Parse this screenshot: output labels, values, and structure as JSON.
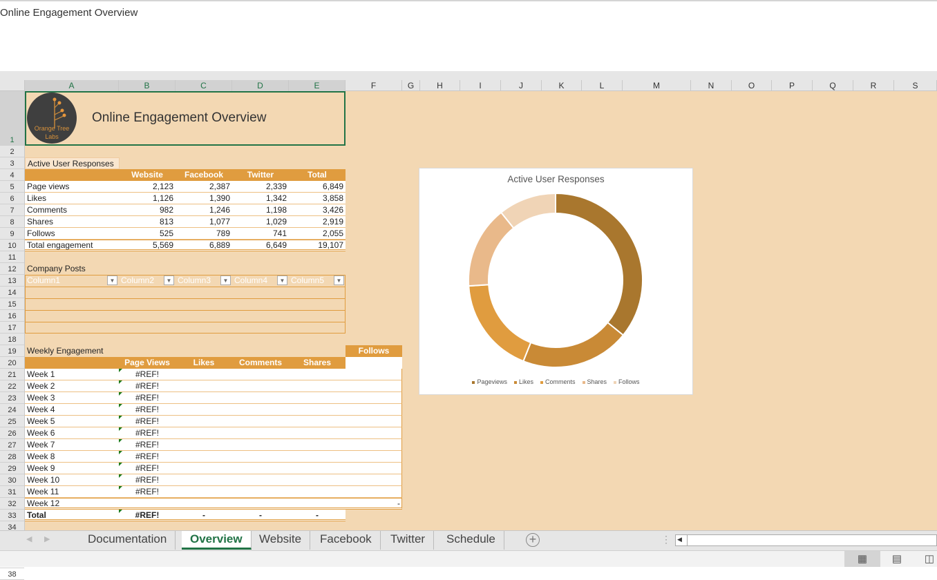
{
  "window": {
    "title": "Online Engagement Overview"
  },
  "columns": [
    "A",
    "B",
    "C",
    "D",
    "E",
    "F",
    "G",
    "H",
    "I",
    "J",
    "K",
    "L",
    "M",
    "N",
    "O",
    "P",
    "Q",
    "R",
    "S"
  ],
  "header": {
    "logo_text": "Orange Tree Labs",
    "title": "Online Engagement Overview"
  },
  "active_user": {
    "label": "Active User Responses",
    "headers": [
      "",
      "Website",
      "Facebook",
      "Twitter",
      "Total"
    ],
    "rows": [
      [
        "Page views",
        "2,123",
        "2,387",
        "2,339",
        "6,849"
      ],
      [
        "Likes",
        "1,126",
        "1,390",
        "1,342",
        "3,858"
      ],
      [
        "Comments",
        "982",
        "1,246",
        "1,198",
        "3,426"
      ],
      [
        "Shares",
        "813",
        "1,077",
        "1,029",
        "2,919"
      ],
      [
        "Follows",
        "525",
        "789",
        "741",
        "2,055"
      ],
      [
        "Total engagement",
        "5,569",
        "6,889",
        "6,649",
        "19,107"
      ]
    ]
  },
  "company_posts": {
    "label": "Company Posts",
    "headers": [
      "Column1",
      "Column2",
      "Column3",
      "Column4",
      "Column5"
    ]
  },
  "weekly": {
    "label": "Weekly Engagement",
    "headers": [
      "",
      "Page Views",
      "Likes",
      "Comments",
      "Shares",
      "Follows"
    ],
    "rows": [
      [
        "Week 1",
        "#REF!"
      ],
      [
        "Week 2",
        "#REF!"
      ],
      [
        "Week 3",
        "#REF!"
      ],
      [
        "Week 4",
        "#REF!"
      ],
      [
        "Week 5",
        "#REF!"
      ],
      [
        "Week 6",
        "#REF!"
      ],
      [
        "Week 7",
        "#REF!"
      ],
      [
        "Week 8",
        "#REF!"
      ],
      [
        "Week 9",
        "#REF!"
      ],
      [
        "Week 10",
        "#REF!"
      ],
      [
        "Week 11",
        "#REF!"
      ],
      [
        "Week 12",
        ""
      ]
    ],
    "week12_follows": "-",
    "total": [
      "Total",
      "#REF!",
      "-",
      "-",
      "-"
    ]
  },
  "chart_data": {
    "type": "pie",
    "donut": true,
    "title": "Active User Responses",
    "categories": [
      "Pageviews",
      "Likes",
      "Comments",
      "Shares",
      "Follows"
    ],
    "values": [
      6849,
      3858,
      3426,
      2919,
      2055
    ],
    "colors": [
      "#a9772e",
      "#c98a36",
      "#e09c3f",
      "#e9b98a",
      "#f0d4b6"
    ],
    "legend": "bottom"
  },
  "tabs": [
    "Documentation",
    "Overview",
    "Website",
    "Facebook",
    "Twitter",
    "Schedule"
  ],
  "active_tab": "Overview",
  "colors": {
    "sheet_bg": "#f3d8b3",
    "header_orange": "#e09c3f",
    "accent_green": "#217346"
  }
}
